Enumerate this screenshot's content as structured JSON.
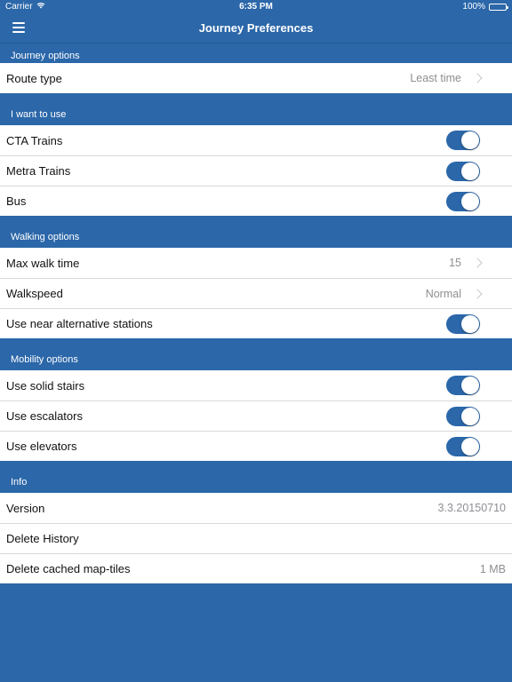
{
  "status_bar": {
    "carrier": "Carrier",
    "time": "6:35 PM",
    "battery": "100%"
  },
  "nav": {
    "title": "Journey Preferences"
  },
  "sections": {
    "journey": {
      "header": "Journey options",
      "route_type_label": "Route type",
      "route_type_value": "Least time"
    },
    "use": {
      "header": "I want to use",
      "cta_label": "CTA Trains",
      "metra_label": "Metra Trains",
      "bus_label": "Bus"
    },
    "walking": {
      "header": "Walking options",
      "max_walk_label": "Max walk time",
      "max_walk_value": "15",
      "walkspeed_label": "Walkspeed",
      "walkspeed_value": "Normal",
      "near_alt_label": "Use near alternative stations"
    },
    "mobility": {
      "header": "Mobility options",
      "stairs_label": "Use solid stairs",
      "escalators_label": "Use escalators",
      "elevators_label": "Use elevators"
    },
    "info": {
      "header": "Info",
      "version_label": "Version",
      "version_value": "3.3.20150710",
      "delete_history_label": "Delete History",
      "delete_tiles_label": "Delete cached map-tiles",
      "delete_tiles_value": "1 MB"
    }
  },
  "colors": {
    "primary": "#2b67a9",
    "toggle_on": "#2b67a9"
  }
}
